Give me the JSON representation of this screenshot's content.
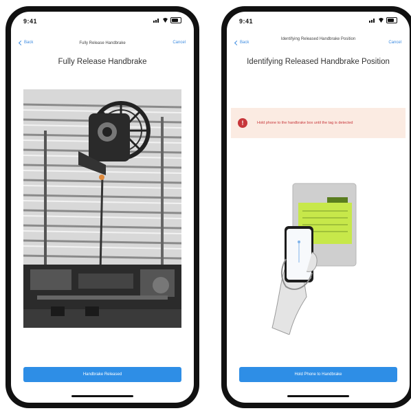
{
  "screens": [
    {
      "status": {
        "time": "9:41"
      },
      "nav": {
        "back_label": "Back",
        "title": "Fully Release Handbrake",
        "cancel_label": "Cancel"
      },
      "heading": "Fully Release Handbrake",
      "primary_button": "Handbrake Released"
    },
    {
      "status": {
        "time": "9:41"
      },
      "nav": {
        "back_label": "Back",
        "title": "Identifying Released Handbrake Position",
        "cancel_label": "Cancel"
      },
      "heading": "Identifying Released Handbrake Position",
      "warning": {
        "icon": "!",
        "text": "Hold phone to the handbrake box until the tag is detected"
      },
      "primary_button": "Hold Phone to Handbrake"
    }
  ]
}
